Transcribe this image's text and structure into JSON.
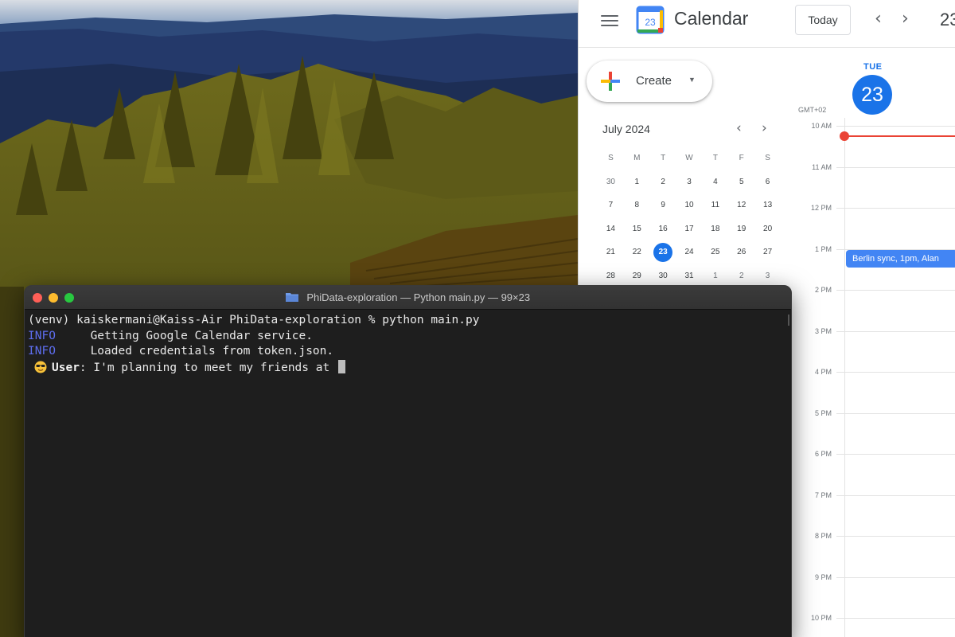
{
  "calendar": {
    "app_title": "Calendar",
    "logo_day": "23",
    "today_label": "Today",
    "prev_arrow": "‹",
    "next_arrow": "›",
    "header_date": "23",
    "create_label": "Create",
    "mini": {
      "month_title": "July 2024",
      "prev": "‹",
      "next": "›",
      "dow": [
        "S",
        "M",
        "T",
        "W",
        "T",
        "F",
        "S"
      ],
      "weeks": [
        [
          "30",
          "1",
          "2",
          "3",
          "4",
          "5",
          "6"
        ],
        [
          "7",
          "8",
          "9",
          "10",
          "11",
          "12",
          "13"
        ],
        [
          "14",
          "15",
          "16",
          "17",
          "18",
          "19",
          "20"
        ],
        [
          "21",
          "22",
          "23",
          "24",
          "25",
          "26",
          "27"
        ],
        [
          "28",
          "29",
          "30",
          "31",
          "1",
          "2",
          "3"
        ]
      ],
      "selected_day": "23"
    },
    "day_view": {
      "dow": "TUE",
      "day_number": "23",
      "timezone": "GMT+02",
      "hours": [
        "10 AM",
        "11 AM",
        "12 PM",
        "1 PM",
        "2 PM",
        "3 PM",
        "4 PM",
        "5 PM",
        "6 PM",
        "7 PM",
        "8 PM",
        "9 PM",
        "10 PM"
      ],
      "event_label": "Berlin sync, 1pm, Alan"
    },
    "colors": {
      "accent": "#1a73e8",
      "now_line": "#ea4335",
      "event": "#4285f4"
    }
  },
  "terminal": {
    "title": "PhiData-exploration — Python main.py — 99×23",
    "lines": [
      {
        "prompt": "(venv) kaiskermani@Kaiss-Air PhiData-exploration % python main.py"
      },
      {
        "level": "INFO",
        "message": "Getting Google Calendar service."
      },
      {
        "level": "INFO",
        "message": "Loaded credentials from token.json."
      }
    ],
    "user_label": "User",
    "user_input": ": I'm planning to meet my friends at ",
    "emoji_icon": "sunglasses-emoji-icon"
  }
}
